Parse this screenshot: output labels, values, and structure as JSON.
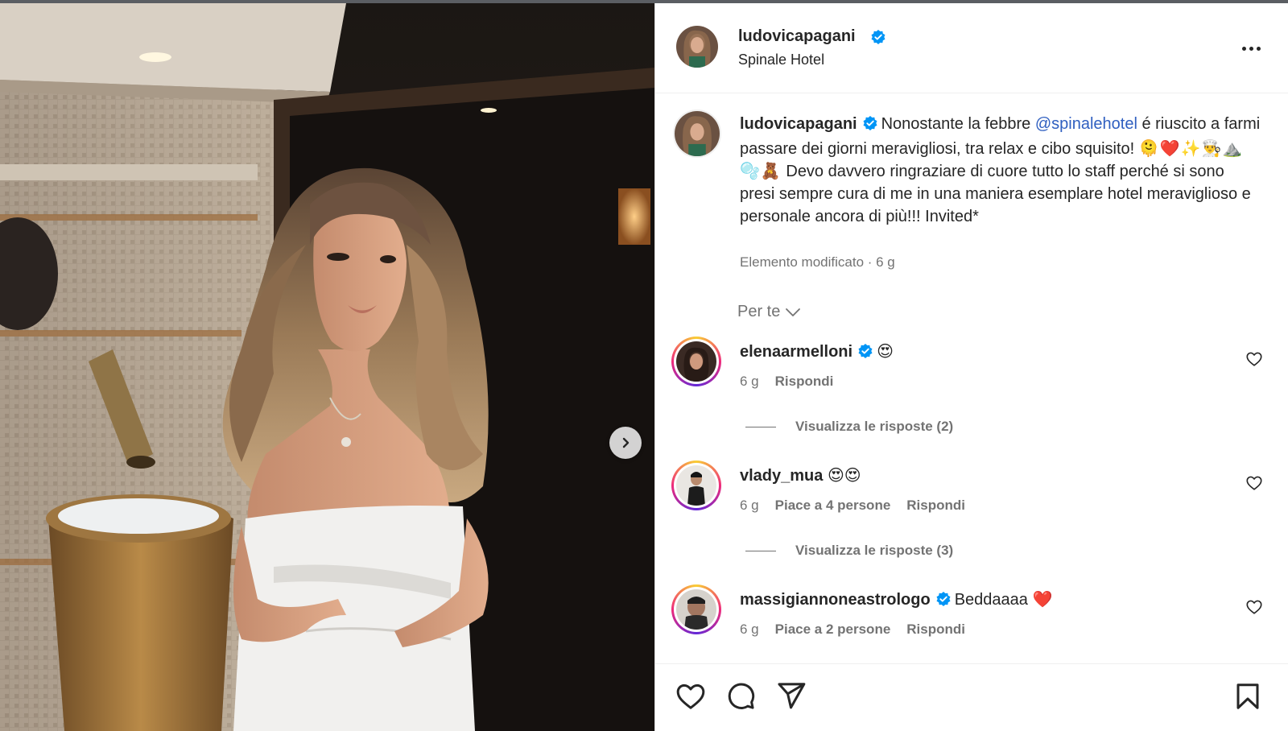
{
  "colors": {
    "link": "#2f5fc0",
    "verified": "#0095f6",
    "heart_red": "#e0242f",
    "muted": "#737373"
  },
  "post": {
    "author": "ludovicapagani",
    "location": "Spinale Hotel",
    "more_icon": "more-horizontal-icon",
    "carousel_next_icon": "chevron-right-icon"
  },
  "caption": {
    "author": "ludovicapagani",
    "text_before_mention": "Nonostante la febbre ",
    "mention": "@spinalehotel",
    "text_after_mention": " é riuscito a farmi passare dei giorni meravigliosi, tra relax e cibo squisito! ",
    "emojis": "🫠❤️✨👨‍🍳⛰️🫧🧸",
    "text_end": " Devo davvero ringraziare di cuore tutto lo staff perché si sono presi sempre cura di me in una maniera esemplare hotel meraviglioso e personale ancora di più!!! Invited*",
    "meta": "Elemento modificato · 6 g"
  },
  "sort": {
    "label": "Per te"
  },
  "comments": [
    {
      "user": "elenaarmelloni",
      "verified": true,
      "text": "😍",
      "time": "6 g",
      "likes": "",
      "reply": "Rispondi",
      "view_replies": "Visualizza le risposte (2)"
    },
    {
      "user": "vlady_mua",
      "verified": false,
      "text": "😍😍",
      "time": "6 g",
      "likes": "Piace a 4 persone",
      "reply": "Rispondi",
      "view_replies": "Visualizza le risposte (3)"
    },
    {
      "user": "massigiannoneastrologo",
      "verified": true,
      "text": "Beddaaaa ❤️",
      "time": "6 g",
      "likes": "Piace a 2 persone",
      "reply": "Rispondi",
      "view_replies": ""
    }
  ],
  "actions": {
    "like_icon": "heart-icon",
    "comment_icon": "comment-icon",
    "share_icon": "send-icon",
    "save_icon": "bookmark-icon"
  }
}
